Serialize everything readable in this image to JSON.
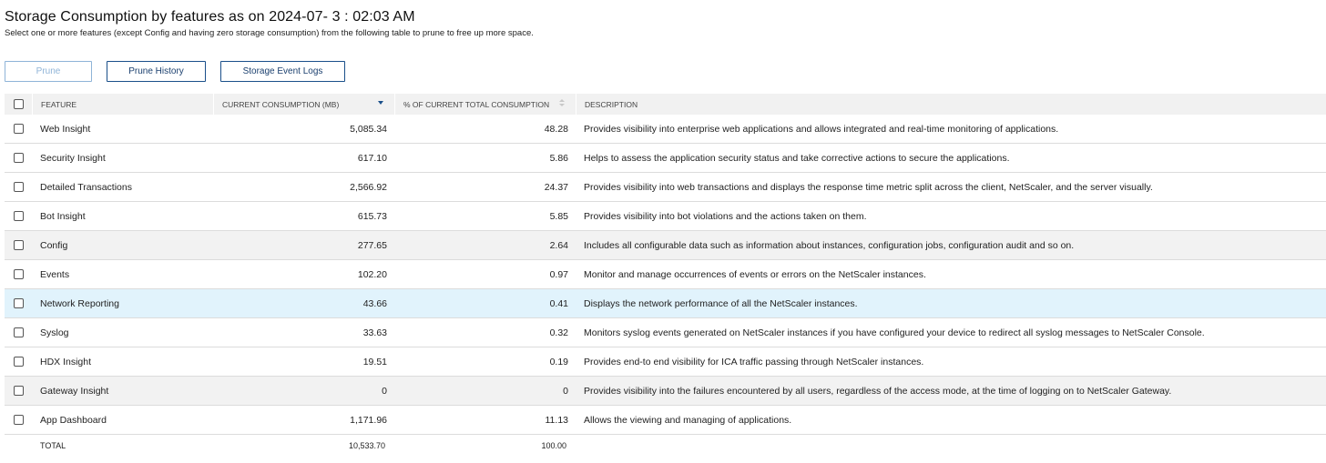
{
  "page": {
    "title": "Storage Consumption by features as on 2024-07- 3 : 02:03 AM",
    "subtitle": "Select one or more features (except Config and having zero storage consumption) from the following table to prune to free up more space."
  },
  "toolbar": {
    "prune_label": "Prune",
    "prune_history_label": "Prune History",
    "storage_event_logs_label": "Storage Event Logs"
  },
  "table": {
    "columns": {
      "feature": "FEATURE",
      "consumption": "CURRENT CONSUMPTION (MB)",
      "percent": "% OF CURRENT TOTAL CONSUMPTION",
      "description": "DESCRIPTION"
    },
    "rows": [
      {
        "feature": "Web Insight",
        "consumption": "5,085.34",
        "percent": "48.28",
        "description": "Provides visibility into enterprise web applications and allows integrated and real-time monitoring of applications."
      },
      {
        "feature": "Security Insight",
        "consumption": "617.10",
        "percent": "5.86",
        "description": "Helps to assess the application security status and take corrective actions to secure the applications."
      },
      {
        "feature": "Detailed Transactions",
        "consumption": "2,566.92",
        "percent": "24.37",
        "description": "Provides visibility into web transactions and displays the response time metric split across the client, NetScaler, and the server visually."
      },
      {
        "feature": "Bot Insight",
        "consumption": "615.73",
        "percent": "5.85",
        "description": "Provides visibility into bot violations and the actions taken on them."
      },
      {
        "feature": "Config",
        "consumption": "277.65",
        "percent": "2.64",
        "description": "Includes all configurable data such as information about instances, configuration jobs, configuration audit and so on."
      },
      {
        "feature": "Events",
        "consumption": "102.20",
        "percent": "0.97",
        "description": "Monitor and manage occurrences of events or errors on the NetScaler instances."
      },
      {
        "feature": "Network Reporting",
        "consumption": "43.66",
        "percent": "0.41",
        "description": "Displays the network performance of all the NetScaler instances."
      },
      {
        "feature": "Syslog",
        "consumption": "33.63",
        "percent": "0.32",
        "description": "Monitors syslog events generated on NetScaler instances if you have configured your device to redirect all syslog messages to NetScaler Console."
      },
      {
        "feature": "HDX Insight",
        "consumption": "19.51",
        "percent": "0.19",
        "description": "Provides end-to end visibility for ICA traffic passing through NetScaler instances."
      },
      {
        "feature": "Gateway Insight",
        "consumption": "0",
        "percent": "0",
        "description": "Provides visibility into the failures encountered by all users, regardless of the access mode, at the time of logging on to NetScaler Gateway."
      },
      {
        "feature": "App Dashboard",
        "consumption": "1,171.96",
        "percent": "11.13",
        "description": "Allows the viewing and managing of applications."
      }
    ],
    "total": {
      "label": "TOTAL",
      "consumption": "10,533.70",
      "percent": "100.00"
    }
  }
}
